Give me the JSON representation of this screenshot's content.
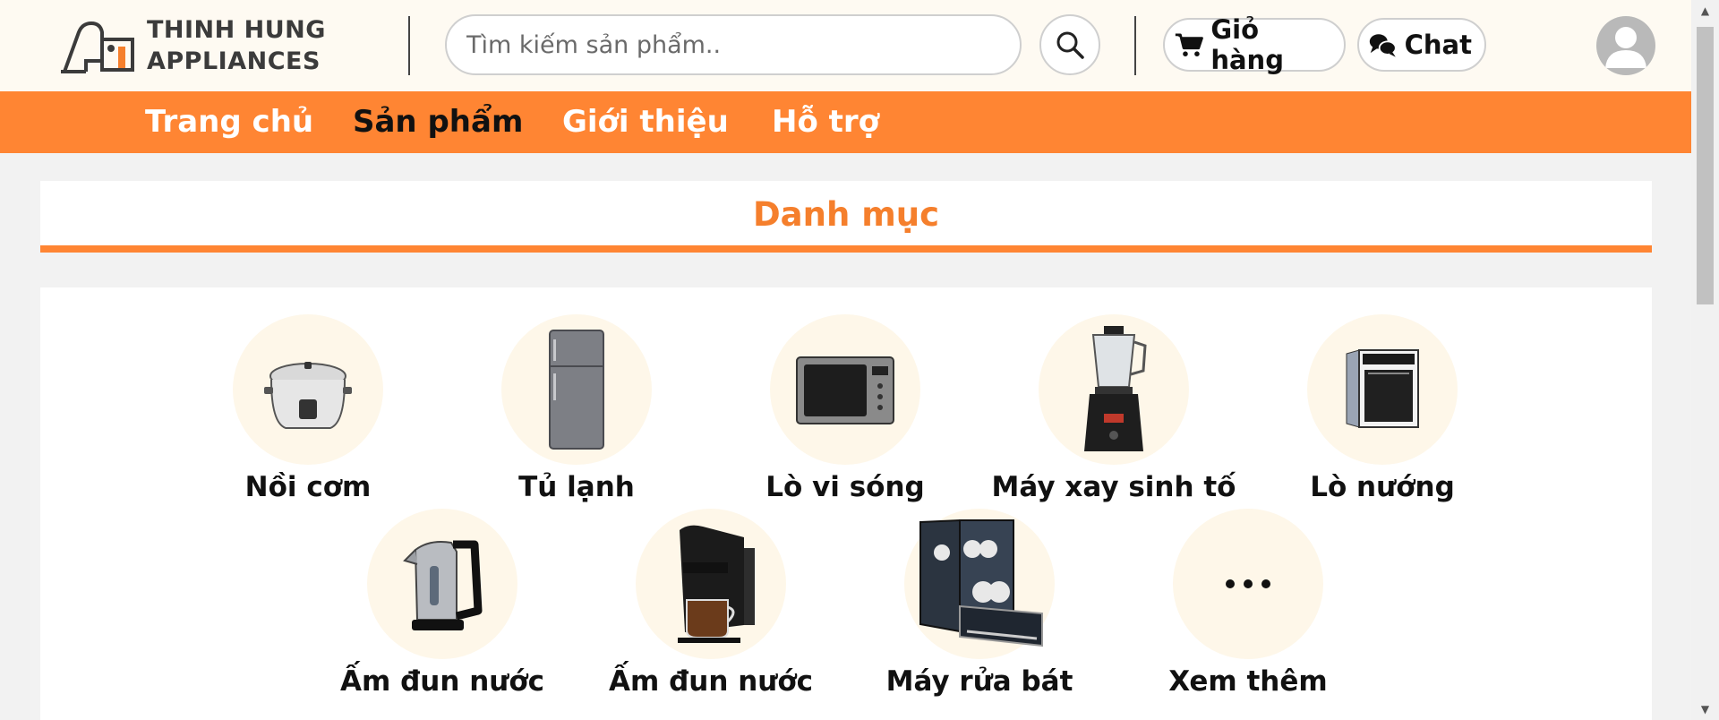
{
  "header": {
    "logo_line1": "THINH HUNG",
    "logo_line2": "APPLIANCES",
    "search": {
      "placeholder": "Tìm kiếm sản phẩm.."
    },
    "cart_label": "Giỏ hàng",
    "chat_label": "Chat"
  },
  "nav": {
    "items": [
      {
        "label": "Trang chủ",
        "active": false
      },
      {
        "label": "Sản phẩm",
        "active": true
      },
      {
        "label": "Giới thiệu",
        "active": false
      },
      {
        "label": "Hỗ trợ",
        "active": false
      }
    ]
  },
  "categories": {
    "title": "Danh mục",
    "items": [
      {
        "label": "Nồi cơm",
        "icon": "rice-cooker-icon"
      },
      {
        "label": "Tủ lạnh",
        "icon": "refrigerator-icon"
      },
      {
        "label": "Lò vi sóng",
        "icon": "microwave-icon"
      },
      {
        "label": "Máy xay sinh tố",
        "icon": "blender-icon"
      },
      {
        "label": "Lò nướng",
        "icon": "oven-icon"
      },
      {
        "label": "Ấm đun nước",
        "icon": "kettle-icon"
      },
      {
        "label": "Ấm đun nước",
        "icon": "coffee-machine-icon"
      },
      {
        "label": "Máy rửa bát",
        "icon": "dishwasher-icon"
      },
      {
        "label": "Xem thêm",
        "icon": "more-dots-icon"
      }
    ]
  },
  "colors": {
    "accent": "#ff8533",
    "title": "#f57f2c",
    "header_bg": "#fefaf2",
    "circle_bg": "#fef7e9"
  }
}
